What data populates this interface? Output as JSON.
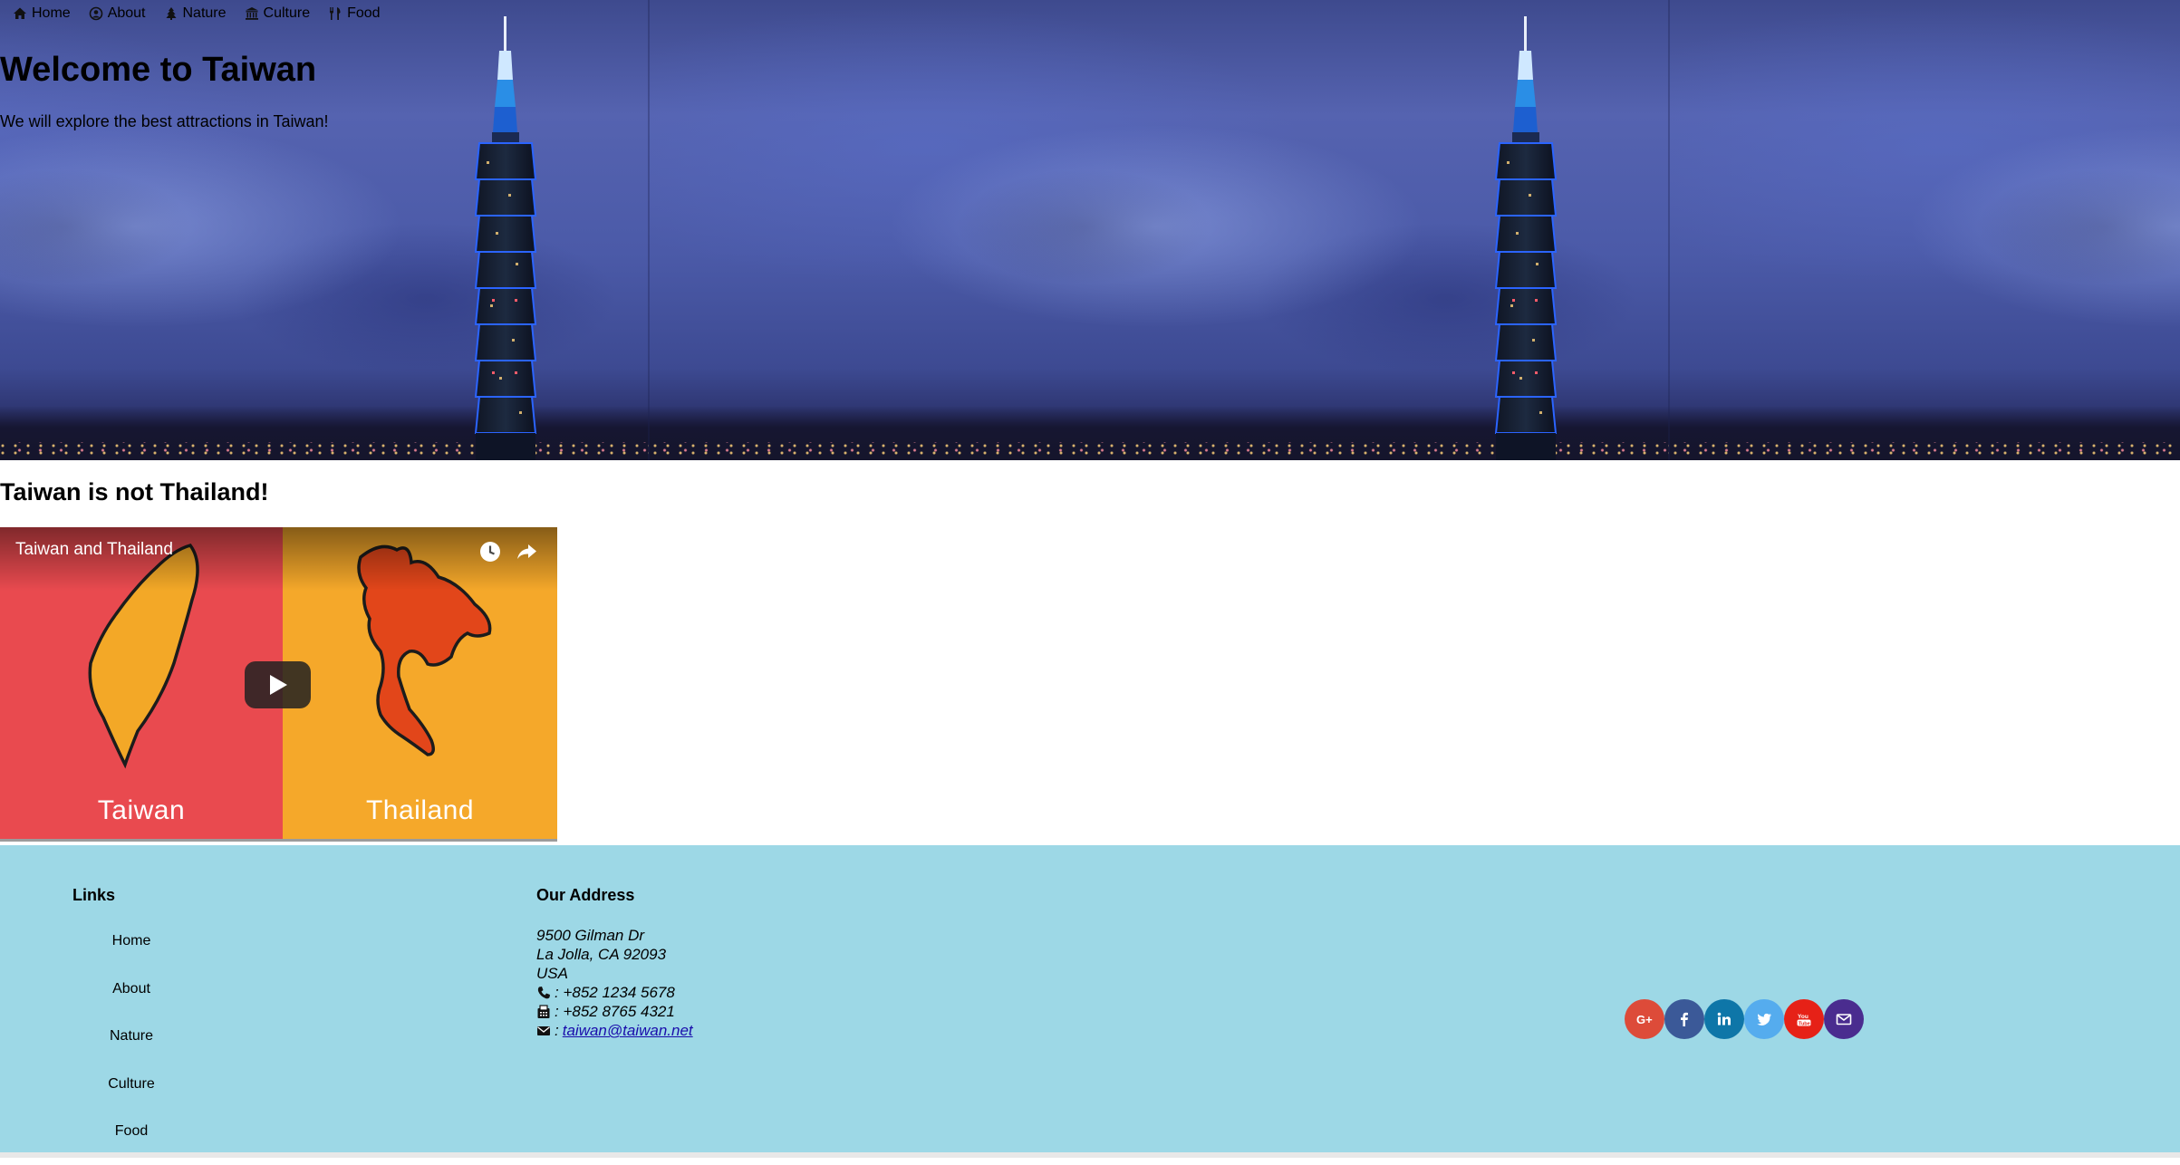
{
  "nav": {
    "items": [
      {
        "label": "Home",
        "icon": "home-icon"
      },
      {
        "label": "About",
        "icon": "user-circle-icon"
      },
      {
        "label": "Nature",
        "icon": "tree-icon"
      },
      {
        "label": "Culture",
        "icon": "museum-icon"
      },
      {
        "label": "Food",
        "icon": "utensils-icon"
      }
    ]
  },
  "hero": {
    "title": "Welcome to Taiwan",
    "subtitle": "We will explore the best attractions in Taiwan!"
  },
  "main": {
    "section_title": "Taiwan is not Thailand!",
    "video": {
      "title": "Taiwan and Thailand",
      "left_label": "Taiwan",
      "right_label": "Thailand",
      "colors": {
        "left": "#e94a4f",
        "right": "#f5a82a"
      }
    }
  },
  "footer": {
    "links_title": "Links",
    "links": [
      "Home",
      "About",
      "Nature",
      "Culture",
      "Food"
    ],
    "address_title": "Our Address",
    "address_lines": [
      "9500 Gilman Dr",
      "La Jolla, CA 92093",
      "USA"
    ],
    "phone": ": +852 1234 5678",
    "fax": ": +852 8765 4321",
    "email_prefix": ":",
    "email": "taiwan@taiwan.net",
    "background": "#9dd8e6",
    "social": [
      {
        "name": "google-plus",
        "color": "#dd4b39"
      },
      {
        "name": "facebook",
        "color": "#3b5998"
      },
      {
        "name": "linkedin",
        "color": "#0e76a8"
      },
      {
        "name": "twitter",
        "color": "#55acee"
      },
      {
        "name": "youtube",
        "color": "#e62117"
      },
      {
        "name": "mail",
        "color": "#4a2c8f"
      }
    ]
  }
}
